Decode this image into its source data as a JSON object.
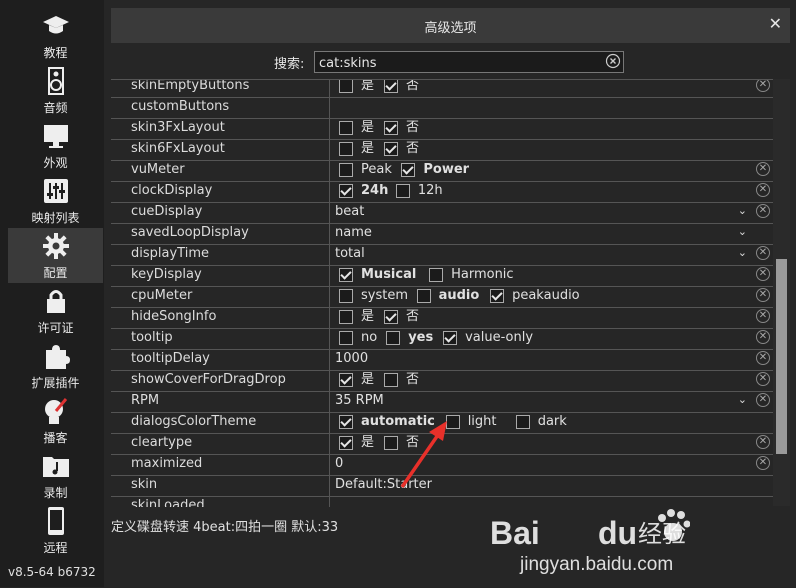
{
  "sidebar": {
    "items": [
      {
        "label": "教程",
        "icon": "graduation-cap-icon"
      },
      {
        "label": "音频",
        "icon": "speaker-icon"
      },
      {
        "label": "外观",
        "icon": "monitor-icon"
      },
      {
        "label": "映射列表",
        "icon": "mixer-sliders-icon"
      },
      {
        "label": "配置",
        "icon": "gear-icon"
      },
      {
        "label": "许可证",
        "icon": "lock-icon"
      },
      {
        "label": "扩展插件",
        "icon": "puzzle-icon"
      },
      {
        "label": "播客",
        "icon": "podcast-icon"
      },
      {
        "label": "录制",
        "icon": "music-folder-icon"
      },
      {
        "label": "远程",
        "icon": "phone-icon"
      }
    ],
    "version": "v8.5-64 b6732"
  },
  "dialog": {
    "title": "高级选项",
    "close": "✕"
  },
  "search": {
    "label": "搜索:",
    "value": "cat:skins"
  },
  "rows": [
    {
      "name": "skinEmptyButtons",
      "opts": [
        {
          "label": "是",
          "checked": false
        },
        {
          "label": "否",
          "checked": true
        }
      ],
      "clear": true
    },
    {
      "name": "customButtons"
    },
    {
      "name": "skin3FxLayout",
      "opts": [
        {
          "label": "是",
          "checked": false
        },
        {
          "label": "否",
          "checked": true
        }
      ]
    },
    {
      "name": "skin6FxLayout",
      "opts": [
        {
          "label": "是",
          "checked": false
        },
        {
          "label": "否",
          "checked": true
        }
      ]
    },
    {
      "name": "vuMeter",
      "opts": [
        {
          "label": "Peak",
          "checked": false
        },
        {
          "label": "Power",
          "checked": true,
          "bold": true
        }
      ],
      "clear": true
    },
    {
      "name": "clockDisplay",
      "opts": [
        {
          "label": "24h",
          "checked": true,
          "bold": true
        },
        {
          "label": "12h",
          "checked": false
        }
      ],
      "clear": true
    },
    {
      "name": "cueDisplay",
      "value": "beat",
      "dropdown": true,
      "clear": true
    },
    {
      "name": "savedLoopDisplay",
      "value": "name",
      "dropdown": true
    },
    {
      "name": "displayTime",
      "value": "total",
      "dropdown": true,
      "clear": true
    },
    {
      "name": "keyDisplay",
      "opts": [
        {
          "label": "Musical",
          "checked": true,
          "bold": true
        },
        {
          "label": "Harmonic",
          "checked": false
        }
      ],
      "clear": true
    },
    {
      "name": "cpuMeter",
      "opts": [
        {
          "label": "system",
          "checked": false
        },
        {
          "label": "audio",
          "checked": false,
          "bold": true
        },
        {
          "label": "peakaudio",
          "checked": true
        }
      ],
      "clear": true
    },
    {
      "name": "hideSongInfo",
      "opts": [
        {
          "label": "是",
          "checked": false
        },
        {
          "label": "否",
          "checked": true
        }
      ],
      "clear": true
    },
    {
      "name": "tooltip",
      "opts": [
        {
          "label": "no",
          "checked": false
        },
        {
          "label": "yes",
          "checked": false,
          "bold": true
        },
        {
          "label": "value-only",
          "checked": true
        }
      ],
      "clear": true
    },
    {
      "name": "tooltipDelay",
      "value": "1000",
      "clear": true
    },
    {
      "name": "showCoverForDragDrop",
      "opts": [
        {
          "label": "是",
          "checked": true
        },
        {
          "label": "否",
          "checked": false
        }
      ],
      "clear": true
    },
    {
      "name": "RPM",
      "value": "35 RPM",
      "dropdown": true,
      "clear": true
    },
    {
      "name": "dialogsColorTheme",
      "opts": [
        {
          "label": "automatic",
          "checked": true,
          "bold": true
        },
        {
          "label": "light",
          "checked": false
        },
        {
          "label": "dark",
          "checked": false
        }
      ]
    },
    {
      "name": "cleartype",
      "opts": [
        {
          "label": "是",
          "checked": true
        },
        {
          "label": "否",
          "checked": false
        }
      ],
      "clear": true
    },
    {
      "name": "maximized",
      "value": "0",
      "clear": true
    },
    {
      "name": "skin",
      "value": "Default:Starter"
    },
    {
      "name": "skinLoaded"
    }
  ],
  "status": "定义碟盘转速  4beat:四拍一圈 默认:33",
  "watermark": {
    "brand_left": "Bai",
    "brand_right": "du",
    "suffix": "经验",
    "url": "jingyan.baidu.com"
  },
  "colors": {
    "background": "#252525",
    "accent_arrow": "#e8302a"
  }
}
